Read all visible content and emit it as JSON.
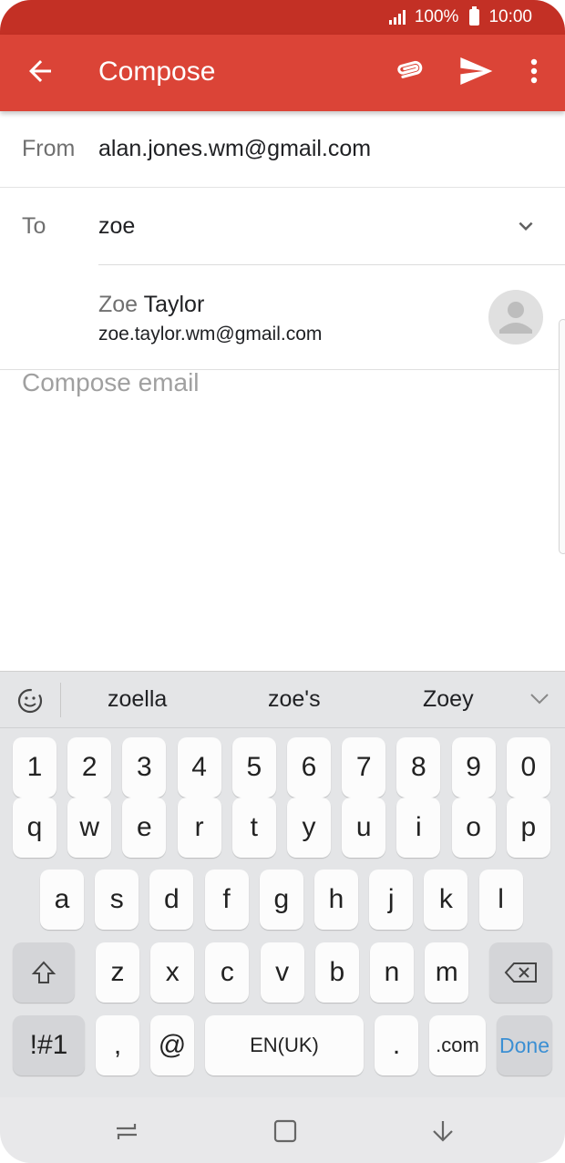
{
  "status_bar": {
    "battery_percent": "100%",
    "time": "10:00"
  },
  "app_bar": {
    "title": "Compose",
    "icons": [
      "back-arrow-icon",
      "paperclip-icon",
      "send-icon",
      "more-vert-icon"
    ],
    "color": "#db4437"
  },
  "from": {
    "label": "From",
    "value": "alan.jones.wm@gmail.com"
  },
  "to": {
    "label": "To",
    "value": "zoe"
  },
  "suggestion": {
    "first_name_match": "Zoe",
    "last_name": " Taylor",
    "email": "zoe.taylor.wm@gmail.com"
  },
  "compose": {
    "placeholder": "Compose email"
  },
  "keyboard": {
    "suggestions": [
      "zoella",
      "zoe's",
      "Zoey"
    ],
    "row_numbers": [
      "1",
      "2",
      "3",
      "4",
      "5",
      "6",
      "7",
      "8",
      "9",
      "0"
    ],
    "row_q": [
      "q",
      "w",
      "e",
      "r",
      "t",
      "y",
      "u",
      "i",
      "o",
      "p"
    ],
    "row_a": [
      "a",
      "s",
      "d",
      "f",
      "g",
      "h",
      "j",
      "k",
      "l"
    ],
    "row_z": [
      "z",
      "x",
      "c",
      "v",
      "b",
      "n",
      "m"
    ],
    "symbols_key": "!#1",
    "comma_key": ",",
    "at_key": "@",
    "space_key": "EN(UK)",
    "period_key": ".",
    "dotcom_key": ".com",
    "done_key": "Done"
  },
  "accent_colors": {
    "app_bar": "#db4437",
    "status_bar": "#c33025",
    "done": "#3b8fd3"
  }
}
